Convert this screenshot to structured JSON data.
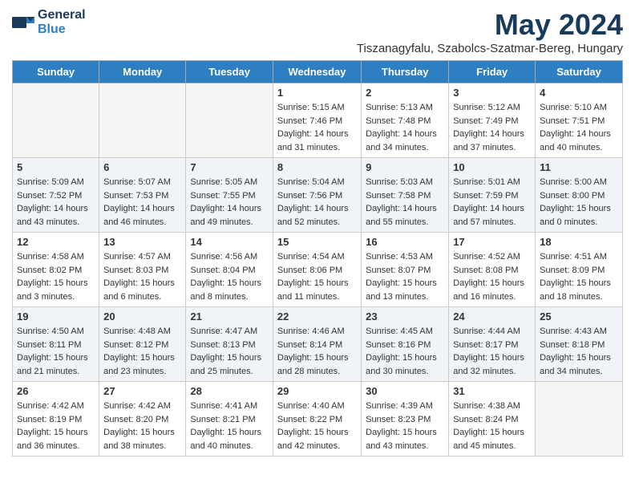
{
  "logo": {
    "general": "General",
    "blue": "Blue"
  },
  "title": "May 2024",
  "location": "Tiszanagyfalu, Szabolcs-Szatmar-Bereg, Hungary",
  "days_of_week": [
    "Sunday",
    "Monday",
    "Tuesday",
    "Wednesday",
    "Thursday",
    "Friday",
    "Saturday"
  ],
  "weeks": [
    [
      {
        "day": "",
        "sunrise": "",
        "sunset": "",
        "daylight": ""
      },
      {
        "day": "",
        "sunrise": "",
        "sunset": "",
        "daylight": ""
      },
      {
        "day": "",
        "sunrise": "",
        "sunset": "",
        "daylight": ""
      },
      {
        "day": "1",
        "sunrise": "Sunrise: 5:15 AM",
        "sunset": "Sunset: 7:46 PM",
        "daylight": "Daylight: 14 hours and 31 minutes."
      },
      {
        "day": "2",
        "sunrise": "Sunrise: 5:13 AM",
        "sunset": "Sunset: 7:48 PM",
        "daylight": "Daylight: 14 hours and 34 minutes."
      },
      {
        "day": "3",
        "sunrise": "Sunrise: 5:12 AM",
        "sunset": "Sunset: 7:49 PM",
        "daylight": "Daylight: 14 hours and 37 minutes."
      },
      {
        "day": "4",
        "sunrise": "Sunrise: 5:10 AM",
        "sunset": "Sunset: 7:51 PM",
        "daylight": "Daylight: 14 hours and 40 minutes."
      }
    ],
    [
      {
        "day": "5",
        "sunrise": "Sunrise: 5:09 AM",
        "sunset": "Sunset: 7:52 PM",
        "daylight": "Daylight: 14 hours and 43 minutes."
      },
      {
        "day": "6",
        "sunrise": "Sunrise: 5:07 AM",
        "sunset": "Sunset: 7:53 PM",
        "daylight": "Daylight: 14 hours and 46 minutes."
      },
      {
        "day": "7",
        "sunrise": "Sunrise: 5:05 AM",
        "sunset": "Sunset: 7:55 PM",
        "daylight": "Daylight: 14 hours and 49 minutes."
      },
      {
        "day": "8",
        "sunrise": "Sunrise: 5:04 AM",
        "sunset": "Sunset: 7:56 PM",
        "daylight": "Daylight: 14 hours and 52 minutes."
      },
      {
        "day": "9",
        "sunrise": "Sunrise: 5:03 AM",
        "sunset": "Sunset: 7:58 PM",
        "daylight": "Daylight: 14 hours and 55 minutes."
      },
      {
        "day": "10",
        "sunrise": "Sunrise: 5:01 AM",
        "sunset": "Sunset: 7:59 PM",
        "daylight": "Daylight: 14 hours and 57 minutes."
      },
      {
        "day": "11",
        "sunrise": "Sunrise: 5:00 AM",
        "sunset": "Sunset: 8:00 PM",
        "daylight": "Daylight: 15 hours and 0 minutes."
      }
    ],
    [
      {
        "day": "12",
        "sunrise": "Sunrise: 4:58 AM",
        "sunset": "Sunset: 8:02 PM",
        "daylight": "Daylight: 15 hours and 3 minutes."
      },
      {
        "day": "13",
        "sunrise": "Sunrise: 4:57 AM",
        "sunset": "Sunset: 8:03 PM",
        "daylight": "Daylight: 15 hours and 6 minutes."
      },
      {
        "day": "14",
        "sunrise": "Sunrise: 4:56 AM",
        "sunset": "Sunset: 8:04 PM",
        "daylight": "Daylight: 15 hours and 8 minutes."
      },
      {
        "day": "15",
        "sunrise": "Sunrise: 4:54 AM",
        "sunset": "Sunset: 8:06 PM",
        "daylight": "Daylight: 15 hours and 11 minutes."
      },
      {
        "day": "16",
        "sunrise": "Sunrise: 4:53 AM",
        "sunset": "Sunset: 8:07 PM",
        "daylight": "Daylight: 15 hours and 13 minutes."
      },
      {
        "day": "17",
        "sunrise": "Sunrise: 4:52 AM",
        "sunset": "Sunset: 8:08 PM",
        "daylight": "Daylight: 15 hours and 16 minutes."
      },
      {
        "day": "18",
        "sunrise": "Sunrise: 4:51 AM",
        "sunset": "Sunset: 8:09 PM",
        "daylight": "Daylight: 15 hours and 18 minutes."
      }
    ],
    [
      {
        "day": "19",
        "sunrise": "Sunrise: 4:50 AM",
        "sunset": "Sunset: 8:11 PM",
        "daylight": "Daylight: 15 hours and 21 minutes."
      },
      {
        "day": "20",
        "sunrise": "Sunrise: 4:48 AM",
        "sunset": "Sunset: 8:12 PM",
        "daylight": "Daylight: 15 hours and 23 minutes."
      },
      {
        "day": "21",
        "sunrise": "Sunrise: 4:47 AM",
        "sunset": "Sunset: 8:13 PM",
        "daylight": "Daylight: 15 hours and 25 minutes."
      },
      {
        "day": "22",
        "sunrise": "Sunrise: 4:46 AM",
        "sunset": "Sunset: 8:14 PM",
        "daylight": "Daylight: 15 hours and 28 minutes."
      },
      {
        "day": "23",
        "sunrise": "Sunrise: 4:45 AM",
        "sunset": "Sunset: 8:16 PM",
        "daylight": "Daylight: 15 hours and 30 minutes."
      },
      {
        "day": "24",
        "sunrise": "Sunrise: 4:44 AM",
        "sunset": "Sunset: 8:17 PM",
        "daylight": "Daylight: 15 hours and 32 minutes."
      },
      {
        "day": "25",
        "sunrise": "Sunrise: 4:43 AM",
        "sunset": "Sunset: 8:18 PM",
        "daylight": "Daylight: 15 hours and 34 minutes."
      }
    ],
    [
      {
        "day": "26",
        "sunrise": "Sunrise: 4:42 AM",
        "sunset": "Sunset: 8:19 PM",
        "daylight": "Daylight: 15 hours and 36 minutes."
      },
      {
        "day": "27",
        "sunrise": "Sunrise: 4:42 AM",
        "sunset": "Sunset: 8:20 PM",
        "daylight": "Daylight: 15 hours and 38 minutes."
      },
      {
        "day": "28",
        "sunrise": "Sunrise: 4:41 AM",
        "sunset": "Sunset: 8:21 PM",
        "daylight": "Daylight: 15 hours and 40 minutes."
      },
      {
        "day": "29",
        "sunrise": "Sunrise: 4:40 AM",
        "sunset": "Sunset: 8:22 PM",
        "daylight": "Daylight: 15 hours and 42 minutes."
      },
      {
        "day": "30",
        "sunrise": "Sunrise: 4:39 AM",
        "sunset": "Sunset: 8:23 PM",
        "daylight": "Daylight: 15 hours and 43 minutes."
      },
      {
        "day": "31",
        "sunrise": "Sunrise: 4:38 AM",
        "sunset": "Sunset: 8:24 PM",
        "daylight": "Daylight: 15 hours and 45 minutes."
      },
      {
        "day": "",
        "sunrise": "",
        "sunset": "",
        "daylight": ""
      }
    ]
  ]
}
